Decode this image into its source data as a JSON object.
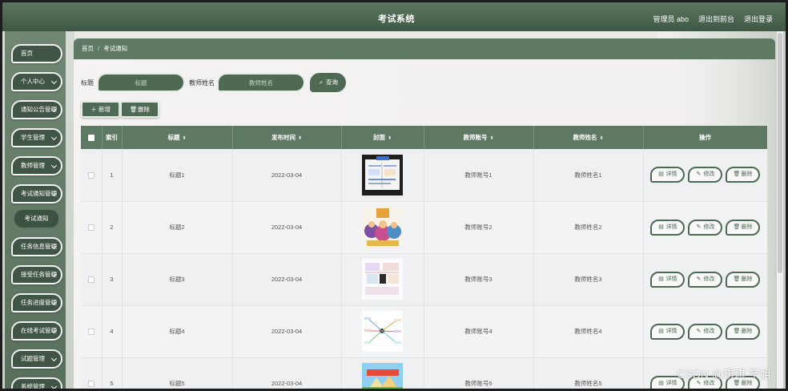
{
  "header": {
    "title": "考试系统",
    "admin": "管理员 abo",
    "exit_front": "退出到前台",
    "logout": "退出登录"
  },
  "sidebar": {
    "items": [
      {
        "label": "首页",
        "expand": false
      },
      {
        "label": "个人中心",
        "expand": true
      },
      {
        "label": "通知公告管理",
        "expand": true
      },
      {
        "label": "学生管理",
        "expand": true
      },
      {
        "label": "教师管理",
        "expand": true
      },
      {
        "label": "考试通知管理",
        "expand": true
      },
      {
        "label": "任务信息管理",
        "expand": true
      },
      {
        "label": "接受任务管理",
        "expand": true
      },
      {
        "label": "任务进度管理",
        "expand": true
      },
      {
        "label": "在线考试管理",
        "expand": true
      },
      {
        "label": "试题管理",
        "expand": true
      },
      {
        "label": "系统管理",
        "expand": true
      }
    ],
    "active_sub": "考试通知"
  },
  "breadcrumb": {
    "home": "首页",
    "sep": "/",
    "current": "考试通知"
  },
  "search": {
    "title_label": "标题",
    "title_placeholder": "标题",
    "teacher_label": "教师姓名",
    "teacher_placeholder": "教师姓名",
    "query_label": "查询"
  },
  "toolbar": {
    "add_label": "新增",
    "delete_label": "删除"
  },
  "table": {
    "headers": [
      "索引",
      "标题",
      "发布时间",
      "封面",
      "教师账号",
      "教师姓名",
      "操作"
    ],
    "rows": [
      {
        "index": "1",
        "title": "标题1",
        "date": "2022-03-04",
        "account": "教师账号1",
        "name": "教师姓名1"
      },
      {
        "index": "2",
        "title": "标题2",
        "date": "2022-03-04",
        "account": "教师账号2",
        "name": "教师姓名2"
      },
      {
        "index": "3",
        "title": "标题3",
        "date": "2022-03-04",
        "account": "教师账号3",
        "name": "教师姓名3"
      },
      {
        "index": "4",
        "title": "标题4",
        "date": "2022-03-04",
        "account": "教师账号4",
        "name": "教师姓名4"
      },
      {
        "index": "5",
        "title": "标题5",
        "date": "2022-03-04",
        "account": "教师账号5",
        "name": "教师姓名5"
      }
    ],
    "actions": {
      "detail": "详情",
      "edit": "修改",
      "delete": "删除"
    }
  },
  "watermark": "CSDN @琪琪 学姐",
  "colors": {
    "primary": "#4f6a54",
    "header": "#5e7963",
    "sidebar": "#6f8773"
  }
}
